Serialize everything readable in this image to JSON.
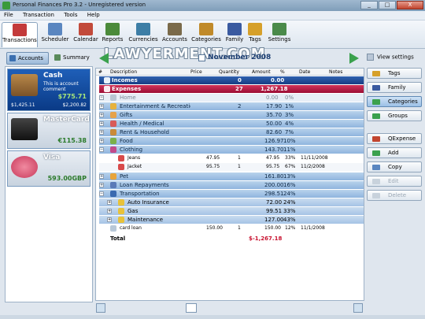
{
  "window": {
    "title": "Personal Finances Pro 3.2 - Unregistered version",
    "minimize": "_",
    "maximize": "□",
    "close": "X"
  },
  "menu": [
    "File",
    "Transaction",
    "Tools",
    "Help"
  ],
  "toolbar": [
    {
      "label": "Transactions",
      "icon": "transactions-icon",
      "color": "#c33a3a"
    },
    {
      "label": "Scheduler",
      "icon": "scheduler-icon",
      "color": "#5a86c0"
    },
    {
      "label": "Calendar",
      "icon": "calendar-icon",
      "color": "#c24a3a"
    },
    {
      "label": "Reports",
      "icon": "reports-icon",
      "color": "#4b8a3a"
    },
    {
      "label": "Currencies",
      "icon": "currencies-icon",
      "color": "#3d7ea6"
    },
    {
      "label": "Accounts",
      "icon": "accounts-icon",
      "color": "#7a6a4a"
    },
    {
      "label": "Categories",
      "icon": "categories-icon",
      "color": "#c08a2a"
    },
    {
      "label": "Family",
      "icon": "family-icon",
      "color": "#3a5aa0"
    },
    {
      "label": "Tags",
      "icon": "tags-icon",
      "color": "#d6a02a"
    },
    {
      "label": "Settings",
      "icon": "settings-icon",
      "color": "#4a8a4a"
    }
  ],
  "watermark": "LAWYERMENT.COM",
  "left_tabs": {
    "accounts": "Accounts",
    "summary": "Summary"
  },
  "accounts": [
    {
      "name": "Cash",
      "comment": "This is account comment",
      "balance": "$775.71",
      "sub1": "$1,425.11",
      "sub2": "$2,200.82"
    },
    {
      "name": "MasterCard",
      "balance": "€115.38"
    },
    {
      "name": "Visa",
      "balance": "593.00GBP"
    }
  ],
  "period": "November 2008",
  "view_settings": "View settings",
  "columns": {
    "num": "#",
    "desc": "Description",
    "price": "Price",
    "qty": "Quantity",
    "amt": "Amount",
    "pct": "%",
    "date": "Date",
    "notes": "Notes"
  },
  "rows": [
    {
      "desc": "Incomes",
      "price": "",
      "qty": "0",
      "amt": "0.00",
      "pct": "",
      "date": "",
      "notes": ""
    },
    {
      "desc": "Expenses",
      "price": "",
      "qty": "27",
      "amt": "1,267.18",
      "pct": "",
      "date": "",
      "notes": ""
    },
    {
      "desc": "Home",
      "price": "",
      "qty": "",
      "amt": "0.00",
      "pct": "0%",
      "date": "",
      "notes": ""
    },
    {
      "desc": "Entertainment & Recreatio",
      "price": "",
      "qty": "2",
      "amt": "17.90",
      "pct": "1%",
      "date": "",
      "notes": ""
    },
    {
      "desc": "Gifts",
      "price": "",
      "qty": "",
      "amt": "35.70",
      "pct": "3%",
      "date": "",
      "notes": ""
    },
    {
      "desc": "Health / Medical",
      "price": "",
      "qty": "",
      "amt": "50.00",
      "pct": "4%",
      "date": "",
      "notes": ""
    },
    {
      "desc": "Rent & Household",
      "price": "",
      "qty": "",
      "amt": "82.60",
      "pct": "7%",
      "date": "",
      "notes": ""
    },
    {
      "desc": "Food",
      "price": "",
      "qty": "",
      "amt": "126.97",
      "pct": "10%",
      "date": "",
      "notes": ""
    },
    {
      "desc": "Clothing",
      "price": "",
      "qty": "",
      "amt": "143.70",
      "pct": "11%",
      "date": "",
      "notes": ""
    },
    {
      "desc": "Jeans",
      "price": "47.95",
      "qty": "1",
      "amt": "47.95",
      "pct": "33%",
      "date": "11/11/2008",
      "notes": ""
    },
    {
      "desc": "Jacket",
      "price": "95.75",
      "qty": "1",
      "amt": "95.75",
      "pct": "67%",
      "date": "11/2/2008",
      "notes": ""
    },
    {
      "desc": "Pet",
      "price": "",
      "qty": "",
      "amt": "161.80",
      "pct": "13%",
      "date": "",
      "notes": ""
    },
    {
      "desc": "Loan Repayments",
      "price": "",
      "qty": "",
      "amt": "200.00",
      "pct": "16%",
      "date": "",
      "notes": ""
    },
    {
      "desc": "Transportation",
      "price": "",
      "qty": "",
      "amt": "298.51",
      "pct": "24%",
      "date": "",
      "notes": ""
    },
    {
      "desc": "Auto Insurance",
      "price": "",
      "qty": "",
      "amt": "72.00",
      "pct": "24%",
      "date": "",
      "notes": ""
    },
    {
      "desc": "Gas",
      "price": "",
      "qty": "",
      "amt": "99.51",
      "pct": "33%",
      "date": "",
      "notes": ""
    },
    {
      "desc": "Maintenance",
      "price": "",
      "qty": "",
      "amt": "127.00",
      "pct": "43%",
      "date": "",
      "notes": ""
    },
    {
      "desc": "card loan",
      "price": "150.00",
      "qty": "1",
      "amt": "150.00",
      "pct": "12%",
      "date": "11/1/2008",
      "notes": ""
    }
  ],
  "total": {
    "label": "Total",
    "amt": "$-1,267.18"
  },
  "right_buttons": [
    "Tags",
    "Family",
    "Categories",
    "Groups",
    "QExpense",
    "Add",
    "Copy",
    "Edit",
    "Delete"
  ]
}
